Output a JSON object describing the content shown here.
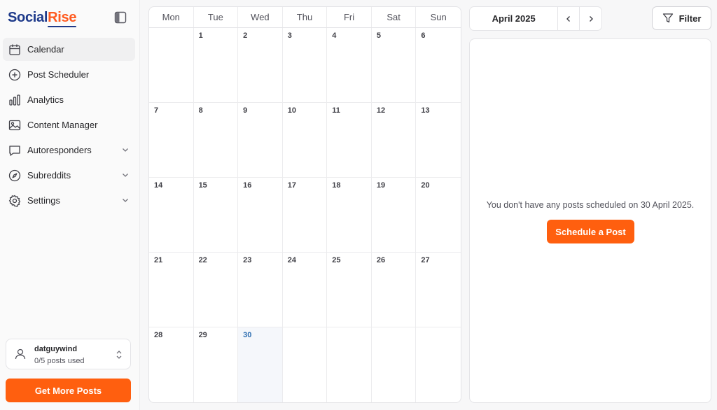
{
  "brand": {
    "part1": "Social",
    "part2": "Rise"
  },
  "sidebar": {
    "items": [
      {
        "label": "Calendar",
        "icon": "calendar-icon",
        "active": true
      },
      {
        "label": "Post Scheduler",
        "icon": "plus-circle-icon"
      },
      {
        "label": "Analytics",
        "icon": "bar-chart-icon"
      },
      {
        "label": "Content Manager",
        "icon": "image-icon"
      },
      {
        "label": "Autoresponders",
        "icon": "message-icon",
        "expandable": true
      },
      {
        "label": "Subreddits",
        "icon": "compass-icon",
        "expandable": true
      },
      {
        "label": "Settings",
        "icon": "gear-icon",
        "expandable": true
      }
    ],
    "user": {
      "name": "datguywind",
      "posts_used": "0/5 posts used"
    },
    "get_more_label": "Get More Posts"
  },
  "calendar": {
    "weekdays": [
      "Mon",
      "Tue",
      "Wed",
      "Thu",
      "Fri",
      "Sat",
      "Sun"
    ],
    "weeks": [
      [
        "",
        "1",
        "2",
        "3",
        "4",
        "5",
        "6"
      ],
      [
        "7",
        "8",
        "9",
        "10",
        "11",
        "12",
        "13"
      ],
      [
        "14",
        "15",
        "16",
        "17",
        "18",
        "19",
        "20"
      ],
      [
        "21",
        "22",
        "23",
        "24",
        "25",
        "26",
        "27"
      ],
      [
        "28",
        "29",
        "30",
        "",
        "",
        "",
        ""
      ]
    ],
    "today": "30",
    "month_label": "April 2025"
  },
  "controls": {
    "filter_label": "Filter"
  },
  "detail": {
    "empty_message": "You don't have any posts scheduled on 30 April 2025.",
    "schedule_label": "Schedule a Post"
  },
  "colors": {
    "accent": "#ff5f0f",
    "brand_blue": "#1e3a8a",
    "today": "#2b6cb0"
  }
}
